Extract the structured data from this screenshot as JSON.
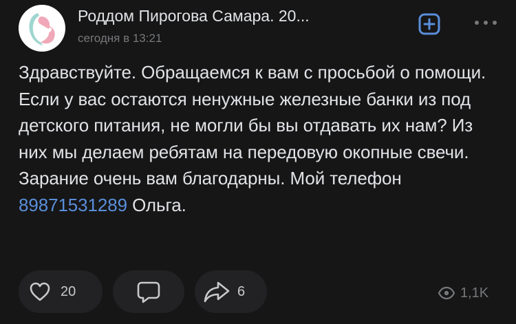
{
  "post": {
    "group_name": "Роддом Пирогова Самара. 20...",
    "timestamp": "сегодня в 13:21",
    "text_before_link": "Здравствуйте. Обращаемся к вам с просьбой о помощи. Если у вас остаются ненужные железные банки из под детского питания, не могли бы вы отдавать их нам? Из них мы делаем ребятам на передовую окопные свечи. Зарание очень вам благодарны. Мой телефон ",
    "phone_link": "89871531289",
    "text_after_link": " Ольга."
  },
  "actions": {
    "likes": "20",
    "shares": "6",
    "views": "1,1K"
  },
  "icons": {
    "avatar": "maternity-logo",
    "subscribe": "plus-square-icon",
    "more": "more-dots-icon",
    "like": "heart-icon",
    "comment": "comment-icon",
    "share": "share-arrow-icon",
    "views": "eye-icon"
  },
  "colors": {
    "background": "#161617",
    "text": "#e1e3e6",
    "secondary_text": "#76787a",
    "link": "#5a8fdb",
    "accent": "#5a8fdb",
    "button_bg": "#222224"
  }
}
